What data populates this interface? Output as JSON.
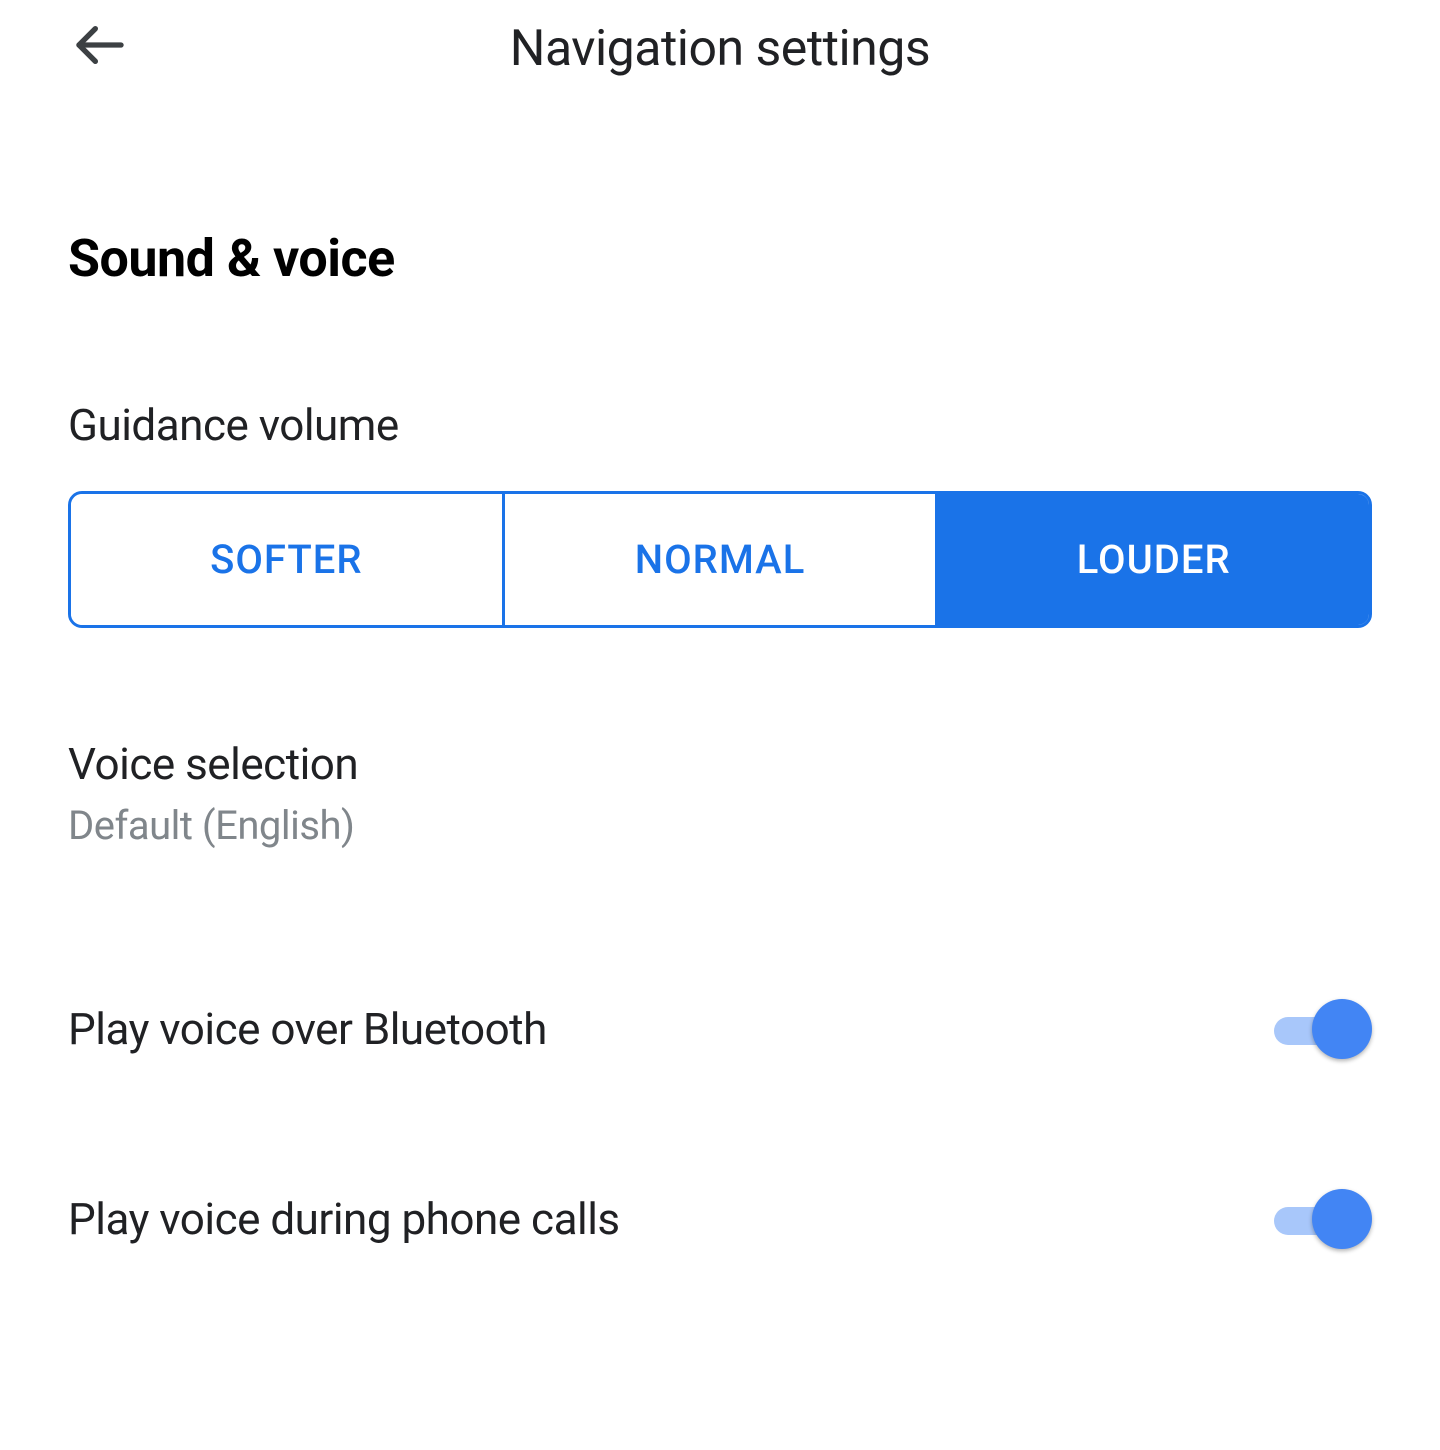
{
  "header": {
    "title": "Navigation settings"
  },
  "section": {
    "title": "Sound & voice"
  },
  "guidance_volume": {
    "label": "Guidance volume",
    "options": {
      "softer": "SOFTER",
      "normal": "NORMAL",
      "louder": "LOUDER"
    },
    "selected": "louder"
  },
  "voice_selection": {
    "title": "Voice selection",
    "subtitle": "Default (English)"
  },
  "bluetooth": {
    "title": "Play voice over Bluetooth",
    "enabled": true
  },
  "phone_calls": {
    "title": "Play voice during phone calls",
    "enabled": true
  }
}
